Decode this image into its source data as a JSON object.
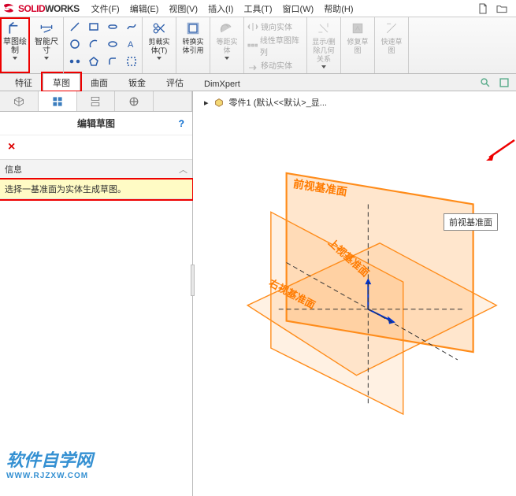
{
  "menubar": {
    "brand_solid": "SOLID",
    "brand_works": "WORKS",
    "items": [
      "文件(F)",
      "编辑(E)",
      "视图(V)",
      "插入(I)",
      "工具(T)",
      "窗口(W)",
      "帮助(H)"
    ]
  },
  "ribbon": {
    "sketch": "草图绘制",
    "dim": "智能尺寸",
    "trim": "剪裁实体(T)",
    "convert": "转换实体引用",
    "offset": "等距实体",
    "mirror": "镜向实体",
    "pattern": "线性草图阵列",
    "move": "移动实体",
    "disprel": "显示/删除几何关系",
    "repair": "修复草图",
    "quick": "快速草图"
  },
  "tabs": {
    "items": [
      "特征",
      "草图",
      "曲面",
      "钣金",
      "评估",
      "DimXpert"
    ],
    "active": 1,
    "highlight": 1
  },
  "panel": {
    "title": "编辑草图",
    "help": "?",
    "close": "×",
    "info_label": "信息",
    "info_text": "选择一基准面为实体生成草图。"
  },
  "breadcrumb": {
    "arrow": "▸",
    "part": "零件1 (默认<<默认>_显..."
  },
  "planes": {
    "front": "前视基准面",
    "top": "上视基准面",
    "right": "右视基准面"
  },
  "tooltip": "前视基准面",
  "watermark": {
    "main": "软件自学网",
    "sub": "WWW.RJZXW.COM"
  }
}
